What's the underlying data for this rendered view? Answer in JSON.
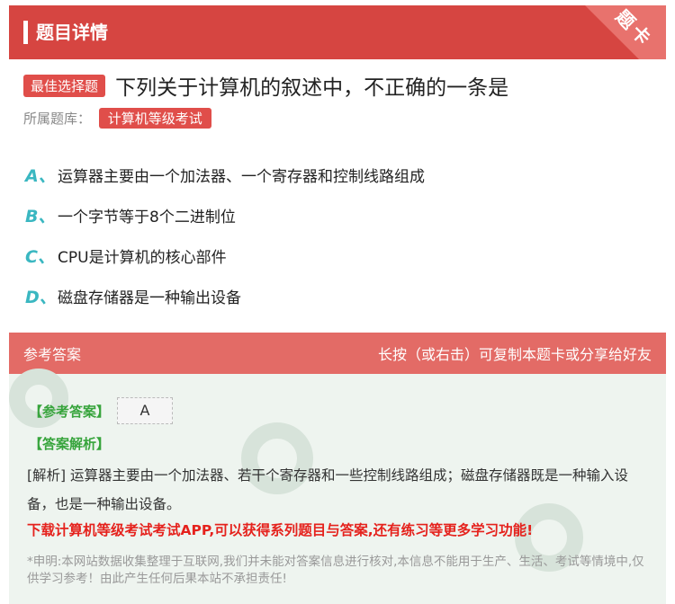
{
  "header": {
    "title": "题目详情",
    "corner_label": "题卡"
  },
  "question": {
    "type_tag": "最佳选择题",
    "text": "下列关于计算机的叙述中，不正确的一条是",
    "source_label": "所属题库：",
    "source_tag": "计算机等级考试"
  },
  "options": [
    {
      "letter": "A、",
      "text": "运算器主要由一个加法器、一个寄存器和控制线路组成"
    },
    {
      "letter": "B、",
      "text": "一个字节等于8个二进制位"
    },
    {
      "letter": "C、",
      "text": "CPU是计算机的核心部件"
    },
    {
      "letter": "D、",
      "text": "磁盘存储器是一种输出设备"
    }
  ],
  "answer": {
    "header_left": "参考答案",
    "header_right": "长按（或右击）可复制本题卡或分享给好友",
    "ref_label": "【参考答案】",
    "ref_value": "A",
    "analysis_label": "【答案解析】",
    "analysis_text": "[解析] 运算器主要由一个加法器、若干个寄存器和一些控制线路组成；磁盘存储器既是一种输入设备，也是一种输出设备。",
    "promo": "下载计算机等级考试考试APP,可以获得系列题目与答案,还有练习等更多学习功能!",
    "disclaimer": "*申明:本网站数据收集整理于互联网,我们并未能对答案信息进行核对,本信息不能用于生产、生活、考试等情境中,仅供学习参考！由此产生任何后果本站不承担责任!"
  },
  "colors": {
    "header": "#d64541",
    "accent_letter": "#3ab7c1",
    "answer_bg": "#eef4ef",
    "answer_header": "#e36b66",
    "promo": "#e5221d"
  }
}
